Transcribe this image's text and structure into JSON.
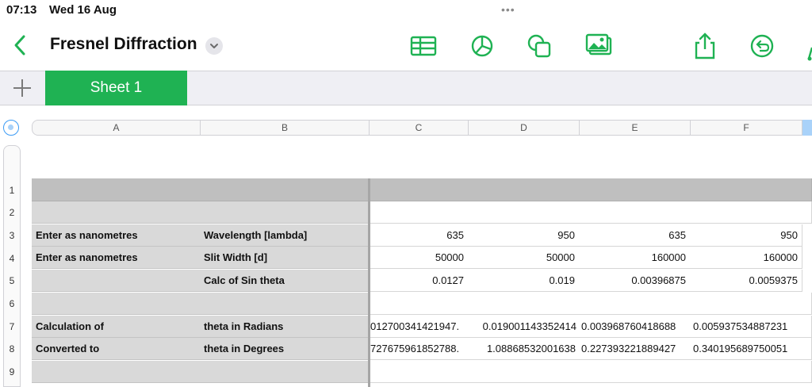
{
  "status_bar": {
    "time": "07:13",
    "date": "Wed 16 Aug",
    "multitask_dots": "•••"
  },
  "toolbar": {
    "document_title": "Fresnel Diffraction",
    "icons": [
      "table-icon",
      "chart-icon",
      "shape-icon",
      "media-icon",
      "share-icon",
      "undo-icon"
    ],
    "accent_color": "#1fb253"
  },
  "tabs": {
    "sheets": [
      "Sheet 1"
    ],
    "add_sheet_label": "+"
  },
  "grid": {
    "columns": [
      "A",
      "B",
      "C",
      "D",
      "E",
      "F"
    ],
    "rows": [
      {
        "num": "1",
        "a": "",
        "b": "",
        "c": "",
        "d": "",
        "e": "",
        "f": ""
      },
      {
        "num": "2",
        "a": "",
        "b": "",
        "c": "",
        "d": "",
        "e": "",
        "f": ""
      },
      {
        "num": "3",
        "a": "Enter as nanometres",
        "b": "Wavelength [lambda]",
        "c": "635",
        "d": "950",
        "e": "635",
        "f": "950"
      },
      {
        "num": "4",
        "a": "Enter as nanometres",
        "b": "Slit Width [d]",
        "c": "50000",
        "d": "50000",
        "e": "160000",
        "f": "160000"
      },
      {
        "num": "5",
        "a": "",
        "b": "Calc of Sin theta",
        "c": "0.0127",
        "d": "0.019",
        "e": "0.00396875",
        "f": "0.0059375"
      },
      {
        "num": "6",
        "a": "",
        "b": "",
        "c": "",
        "d": "",
        "e": "",
        "f": ""
      },
      {
        "num": "7",
        "a": "Calculation of",
        "b": "theta in Radians",
        "c": ".012700341421947",
        "d": "0.019001143352414",
        "e": "0.003968760418688",
        "f": "0.005937534887231"
      },
      {
        "num": "8",
        "a": "Converted to",
        "b": "theta in Degrees",
        "c": ".727675961852788",
        "d": "1.08868532001638",
        "e": "0.227393221889427",
        "f": "0.340195689750051"
      },
      {
        "num": "9",
        "a": "",
        "b": "",
        "c": "",
        "d": "",
        "e": "",
        "f": ""
      }
    ]
  }
}
